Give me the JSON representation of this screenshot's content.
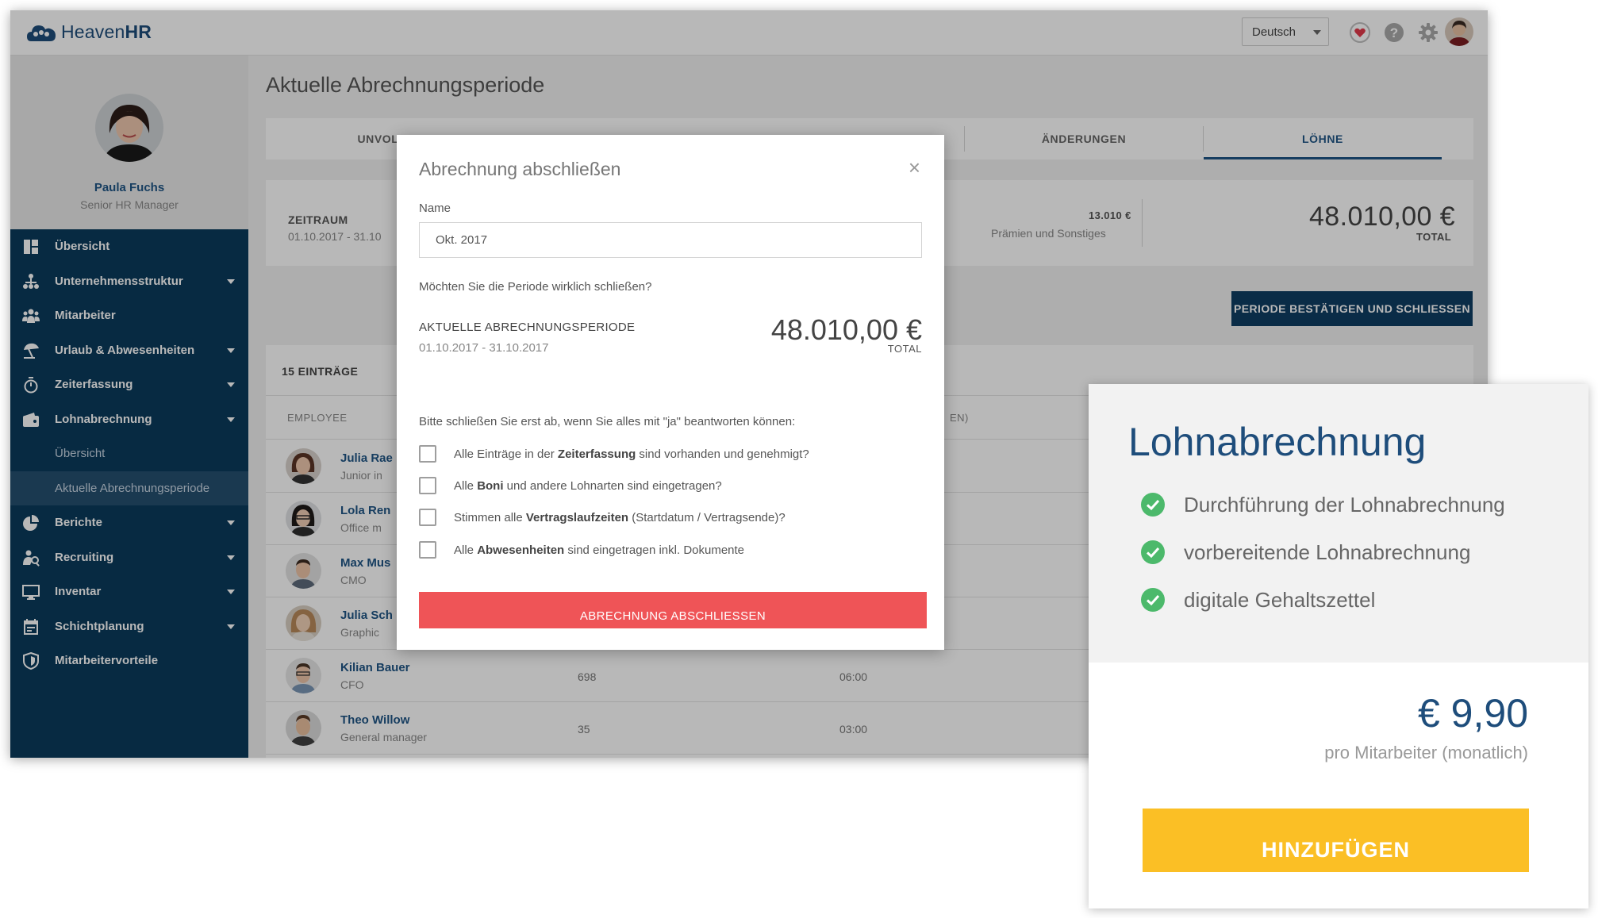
{
  "app": {
    "logo_text_prefix": "Heaven",
    "logo_text_suffix": "HR",
    "language": "Deutsch"
  },
  "profile": {
    "name": "Paula Fuchs",
    "role": "Senior HR Manager"
  },
  "sidebar": {
    "items": [
      {
        "label": "Übersicht",
        "icon": "grid-icon",
        "has_caret": false
      },
      {
        "label": "Unternehmensstruktur",
        "icon": "org-chart-icon",
        "has_caret": true
      },
      {
        "label": "Mitarbeiter",
        "icon": "people-icon",
        "has_caret": false
      },
      {
        "label": "Urlaub & Abwesenheiten",
        "icon": "beach-umbrella-icon",
        "has_caret": true
      },
      {
        "label": "Zeiterfassung",
        "icon": "stopwatch-icon",
        "has_caret": true
      },
      {
        "label": "Lohnabrechnung",
        "icon": "wallet-icon",
        "has_caret": true
      }
    ],
    "sub_items": [
      {
        "label": "Übersicht",
        "active": false
      },
      {
        "label": "Aktuelle Abrechnungsperiode",
        "active": true
      }
    ],
    "items_after": [
      {
        "label": "Berichte",
        "icon": "pie-chart-icon",
        "has_caret": true
      },
      {
        "label": "Recruiting",
        "icon": "recruiting-icon",
        "has_caret": true
      },
      {
        "label": "Inventar",
        "icon": "monitor-icon",
        "has_caret": true
      },
      {
        "label": "Schichtplanung",
        "icon": "calendar-icon",
        "has_caret": true
      },
      {
        "label": "Mitarbeitervorteile",
        "icon": "shield-icon",
        "has_caret": false
      }
    ]
  },
  "main": {
    "page_title": "Aktuelle Abrechnungsperiode",
    "tabs": [
      "UNVOLLS",
      "ÄNDERUNGEN",
      "LÖHNE"
    ],
    "summary": {
      "period_label": "ZEITRAUM",
      "period_dates": "01.10.2017 - 31.10",
      "bonus_amount": "13.010 €",
      "bonus_label": "Prämien und Sonstiges",
      "total_amount": "48.010,00 €",
      "total_label": "TOTAL"
    },
    "confirm_button": "PERIODE BESTÄTIGEN UND SCHLIESSEN",
    "table": {
      "entries": "15 EINTRÄGE",
      "header_employee": "EMPLOYEE",
      "header_partial": "EN)",
      "rows": [
        {
          "name": "Julia Rae",
          "title": "Junior in",
          "v1": "",
          "v2": ""
        },
        {
          "name": "Lola Ren",
          "title": "Office m",
          "v1": "",
          "v2": ""
        },
        {
          "name": "Max Mus",
          "title": "CMO",
          "v1": "",
          "v2": ""
        },
        {
          "name": "Julia Sch",
          "title": "Graphic",
          "v1": "",
          "v2": ""
        },
        {
          "name": "Kilian Bauer",
          "title": "CFO",
          "v1": "698",
          "v2": "06:00"
        },
        {
          "name": "Theo Willow",
          "title": "General manager",
          "v1": "35",
          "v2": "03:00"
        }
      ]
    }
  },
  "modal": {
    "title": "Abrechnung abschließen",
    "name_label": "Name",
    "name_value": "Okt. 2017",
    "question": "Möchten Sie die Periode wirklich schließen?",
    "period_label": "AKTUELLE ABRECHNUNGSPERIODE",
    "period_dates": "01.10.2017 -  31.10.2017",
    "amount": "48.010,00 €",
    "total_label": "TOTAL",
    "instruction": "Bitte schließen Sie erst ab, wenn Sie alles mit \"ja\" beantworten können:",
    "checks": [
      {
        "pre": "Alle Einträge in der ",
        "bold": "Zeiterfassung",
        "post": " sind vorhanden und genehmigt?"
      },
      {
        "pre": "Alle ",
        "bold": "Boni",
        "post": " und andere Lohnarten sind eingetragen?"
      },
      {
        "pre": "Stimmen alle ",
        "bold": "Vertragslaufzeiten",
        "post": " (Startdatum / Vertragsende)?"
      },
      {
        "pre": "Alle ",
        "bold": "Abwesenheiten",
        "post": " sind eingetragen inkl. Dokumente"
      }
    ],
    "submit_label": "ABRECHNUNG ABSCHLIESSEN"
  },
  "promo": {
    "title": "Lohnabrechnung",
    "features": [
      "Durchführung der Lohnabrechnung",
      "vorbereitende Lohnabrechnung",
      "digitale Gehaltszettel"
    ],
    "price": "€ 9,90",
    "price_sub": "pro Mitarbeiter (monatlich)",
    "button": "HINZUFÜGEN",
    "accent_color": "#fbbf25",
    "check_color": "#4cb96b"
  }
}
